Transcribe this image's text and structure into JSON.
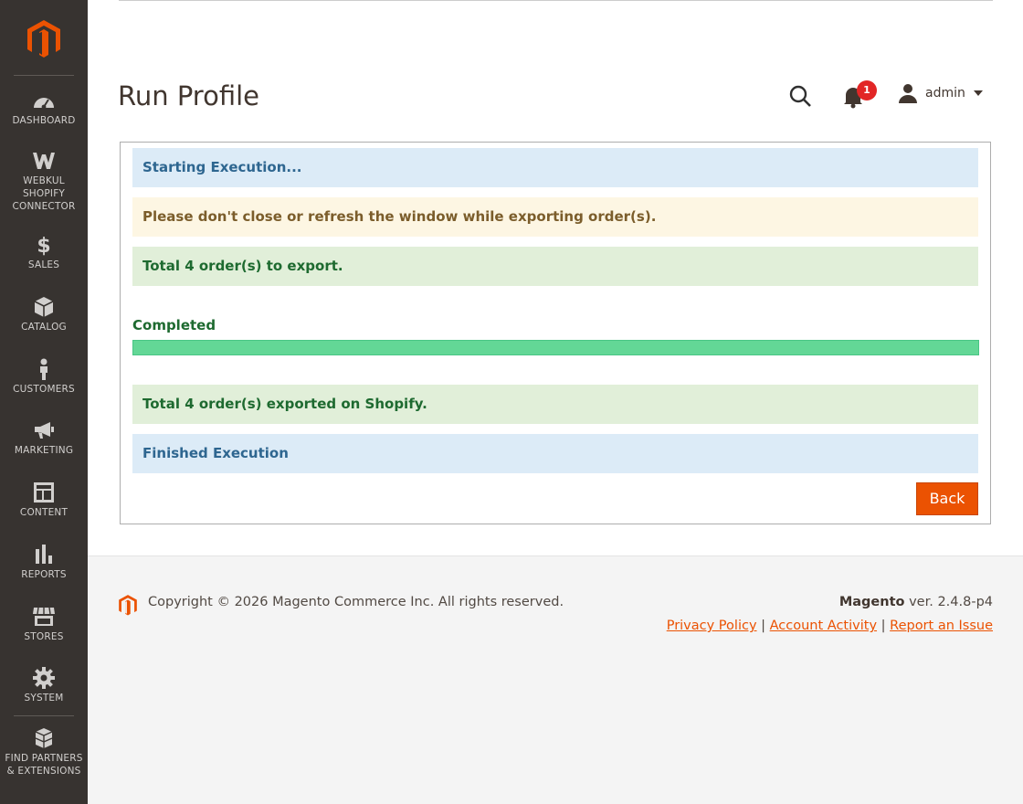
{
  "sidebar": {
    "items": [
      {
        "label": "DASHBOARD",
        "icon": "dashboard-icon"
      },
      {
        "label": "WEBKUL SHOPIFY CONNECTOR",
        "line1": "WEBKUL",
        "line2": "SHOPIFY",
        "line3": "CONNECTOR",
        "icon": "webkul-icon"
      },
      {
        "label": "SALES",
        "icon": "dollar-icon"
      },
      {
        "label": "CATALOG",
        "icon": "box-icon"
      },
      {
        "label": "CUSTOMERS",
        "icon": "person-icon"
      },
      {
        "label": "MARKETING",
        "icon": "megaphone-icon"
      },
      {
        "label": "CONTENT",
        "icon": "layout-icon"
      },
      {
        "label": "REPORTS",
        "icon": "bar-chart-icon"
      },
      {
        "label": "STORES",
        "icon": "storefront-icon"
      },
      {
        "label": "SYSTEM",
        "icon": "gear-icon"
      },
      {
        "label": "FIND PARTNERS & EXTENSIONS",
        "line1": "FIND PARTNERS",
        "line2": "& EXTENSIONS",
        "icon": "blocks-icon"
      }
    ]
  },
  "header": {
    "title": "Run Profile",
    "notification_count": "1",
    "user_name": "admin"
  },
  "messages": {
    "starting": "Starting Execution...",
    "warning": "Please don't close or refresh the window while exporting order(s).",
    "total": "Total 4 order(s) to export.",
    "exported": "Total 4 order(s) exported on Shopify.",
    "finished": "Finished Execution"
  },
  "progress": {
    "label": "Completed",
    "percent": 100
  },
  "buttons": {
    "back": "Back"
  },
  "footer": {
    "copyright": "Copyright © 2026 Magento Commerce Inc. All rights reserved.",
    "brand": "Magento",
    "version": " ver. 2.4.8-p4",
    "links": {
      "privacy": "Privacy Policy",
      "activity": "Account Activity",
      "report": "Report an Issue"
    }
  },
  "colors": {
    "accent": "#eb5202",
    "sidebar_bg": "#373330",
    "progress": "#63d796"
  }
}
